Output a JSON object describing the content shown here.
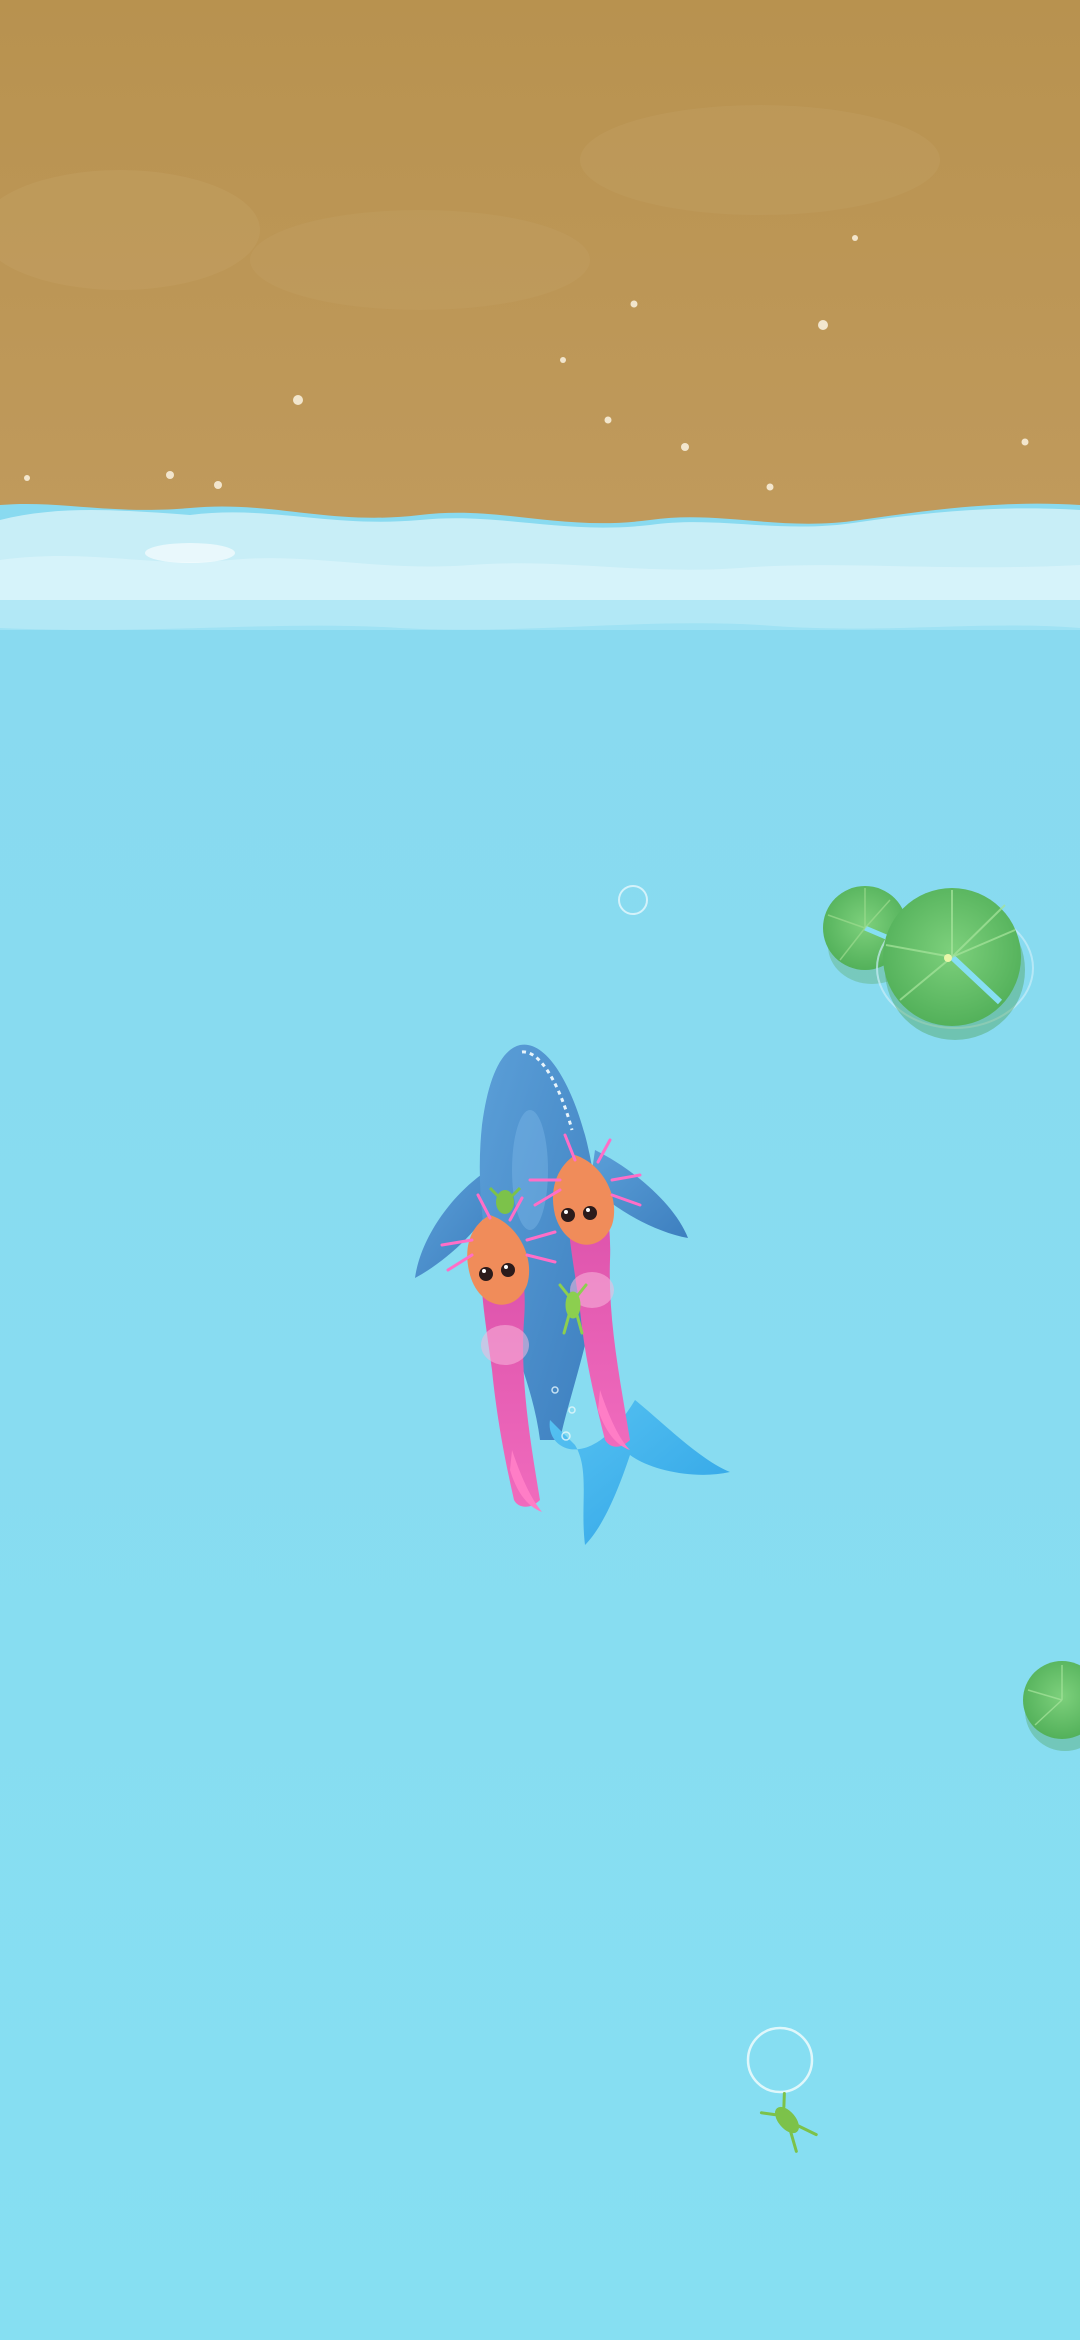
{
  "scene": {
    "type": "koi-pond-game",
    "colors": {
      "sand": "#b8924f",
      "sand_light": "#c9a56a",
      "foam": "#c8eef7",
      "water": "#86dff2",
      "lily_pad": "#66c06a",
      "whale": "#4a8fcf",
      "whale_tail": "#3fb6ee",
      "koi_body": "#e85ab2",
      "koi_face": "#f08c5a",
      "frog": "#7cc24a"
    },
    "objects": {
      "whale": "whale-fish",
      "koi": [
        "koi-fish-left",
        "koi-fish-right"
      ],
      "lily_pads": [
        "lily-pad-large",
        "lily-pad-small",
        "lily-pad-edge"
      ],
      "frogs": [
        "frog-on-whale",
        "frog-swimming-small",
        "frog-swimming-bottom"
      ],
      "bubbles": [
        "bubble-ring-top",
        "bubble-ring-bottom"
      ]
    }
  }
}
